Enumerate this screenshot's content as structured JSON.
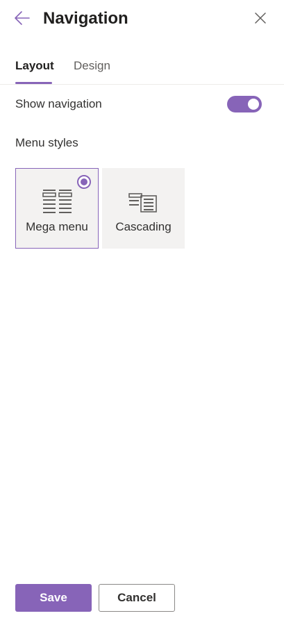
{
  "header": {
    "title": "Navigation",
    "back_icon": "arrow-left-icon",
    "close_icon": "close-icon"
  },
  "tabs": [
    {
      "label": "Layout",
      "selected": true
    },
    {
      "label": "Design",
      "selected": false
    }
  ],
  "show_navigation": {
    "label": "Show navigation",
    "enabled": true
  },
  "menu_styles": {
    "label": "Menu styles",
    "options": [
      {
        "label": "Mega menu",
        "selected": true,
        "icon": "mega-menu-icon"
      },
      {
        "label": "Cascading",
        "selected": false,
        "icon": "cascading-menu-icon"
      }
    ]
  },
  "footer": {
    "save_label": "Save",
    "cancel_label": "Cancel"
  },
  "colors": {
    "accent": "#8764b8",
    "text": "#323130",
    "option_bg": "#f3f2f1"
  }
}
